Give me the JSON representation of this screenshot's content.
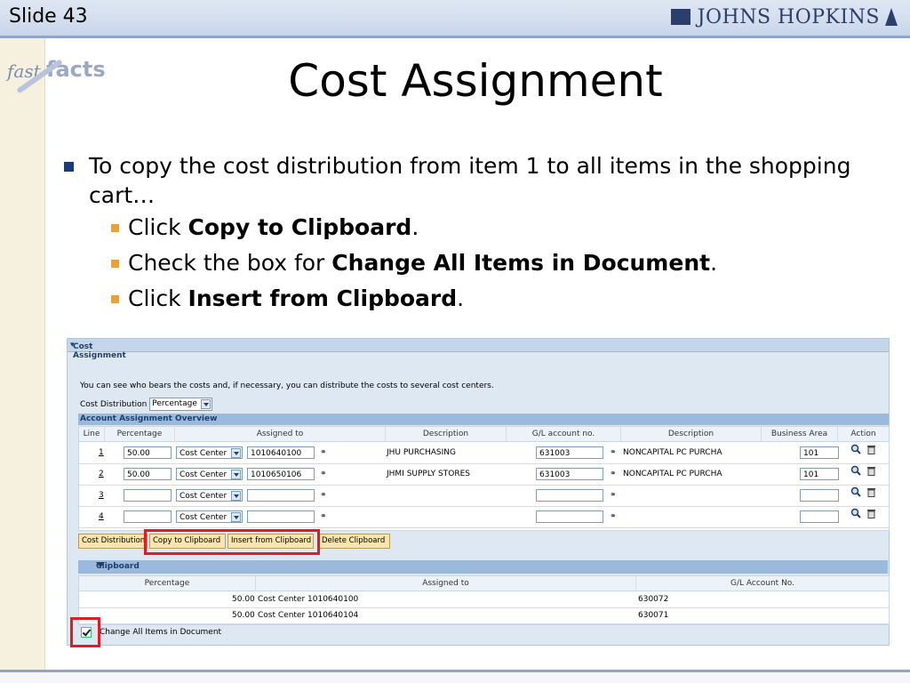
{
  "header": {
    "slide_label": "Slide 43",
    "logo_text": "JOHNS HOPKINS"
  },
  "badge": {
    "fast": "fast",
    "facts": "facts"
  },
  "title": "Cost Assignment",
  "bullets": {
    "main": "To copy the cost distribution from item 1 to all items in the shopping cart…",
    "sub": [
      {
        "pre": "Click ",
        "bold": "Copy to Clipboard",
        "post": "."
      },
      {
        "pre": "Check the box for ",
        "bold": "Change All Items in Document",
        "post": "."
      },
      {
        "pre": "Click ",
        "bold": "Insert from Clipboard",
        "post": "."
      }
    ]
  },
  "sap": {
    "section_title": "Cost Assignment",
    "info_text": "You can see who bears the costs and, if necessary, you can distribute the costs to several cost centers.",
    "cost_distribution_label": "Cost Distribution",
    "cost_distribution_value": "Percentage",
    "overview_title": "Account Assignment Overview",
    "columns": [
      "Line",
      "Percentage",
      "Assigned to",
      "Description",
      "G/L account no.",
      "Description",
      "Business Area",
      "Action"
    ],
    "rows": [
      {
        "line": "1",
        "pct": "50.00",
        "type": "Cost Center",
        "assigned": "1010640100",
        "desc": "JHU PURCHASING",
        "gl": "631003",
        "gldesc": "NONCAPITAL PC PURCHA",
        "ba": "101"
      },
      {
        "line": "2",
        "pct": "50.00",
        "type": "Cost Center",
        "assigned": "1010650106",
        "desc": "JHMI SUPPLY STORES",
        "gl": "631003",
        "gldesc": "NONCAPITAL PC PURCHA",
        "ba": "101"
      },
      {
        "line": "3",
        "pct": "",
        "type": "Cost Center",
        "assigned": "",
        "desc": "",
        "gl": "",
        "gldesc": "",
        "ba": ""
      },
      {
        "line": "4",
        "pct": "",
        "type": "Cost Center",
        "assigned": "",
        "desc": "",
        "gl": "",
        "gldesc": "",
        "ba": ""
      }
    ],
    "buttons": {
      "cost_distribution": "Cost Distribution",
      "copy": "Copy to Clipboard",
      "insert": "Insert from Clipboard",
      "delete": "Delete Clipboard"
    },
    "clipboard": {
      "title": "Clipboard",
      "columns": [
        "Percentage",
        "Assigned to",
        "G/L Account No."
      ],
      "rows": [
        {
          "pct": "50.00",
          "assigned": "Cost Center  1010640100",
          "gl": "630072"
        },
        {
          "pct": "50.00",
          "assigned": "Cost Center  1010640104",
          "gl": "630071"
        }
      ]
    },
    "change_all_label": "Change All Items in Document",
    "change_all_checked": true
  },
  "colors": {
    "accent_red": "#e01b24",
    "button_bg": "#f9e5b0",
    "header_blue": "#9ab9dd"
  }
}
